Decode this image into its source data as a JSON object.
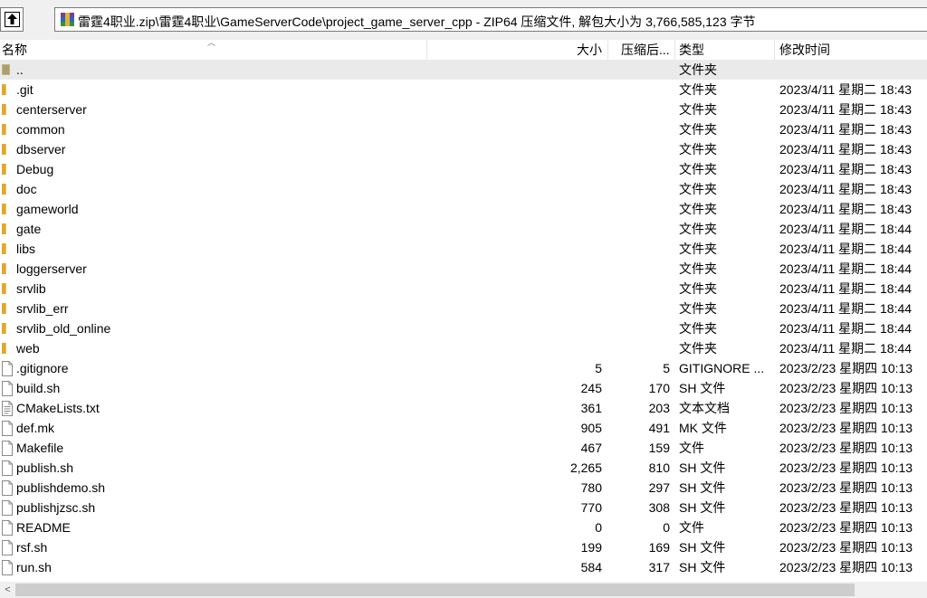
{
  "address_bar": {
    "path": "雷霆4职业.zip\\雷霆4职业\\GameServerCode\\project_game_server_cpp - ZIP64 压缩文件, 解包大小为 3,766,585,123 字节"
  },
  "columns": {
    "name": "名称",
    "size": "大小",
    "packed": "压缩后...",
    "type": "类型",
    "modified": "修改时间"
  },
  "colors": {
    "folder": "#f5c04a",
    "selected_row": "#eaeaea"
  },
  "rows": [
    {
      "icon": "parent-folder-icon",
      "name": "..",
      "size": "",
      "packed": "",
      "type": "文件夹",
      "modified": ""
    },
    {
      "icon": "folder-icon",
      "name": ".git",
      "size": "",
      "packed": "",
      "type": "文件夹",
      "modified": "2023/4/11 星期二 18:43"
    },
    {
      "icon": "folder-icon",
      "name": "centerserver",
      "size": "",
      "packed": "",
      "type": "文件夹",
      "modified": "2023/4/11 星期二 18:43"
    },
    {
      "icon": "folder-icon",
      "name": "common",
      "size": "",
      "packed": "",
      "type": "文件夹",
      "modified": "2023/4/11 星期二 18:43"
    },
    {
      "icon": "folder-icon",
      "name": "dbserver",
      "size": "",
      "packed": "",
      "type": "文件夹",
      "modified": "2023/4/11 星期二 18:43"
    },
    {
      "icon": "folder-icon",
      "name": "Debug",
      "size": "",
      "packed": "",
      "type": "文件夹",
      "modified": "2023/4/11 星期二 18:43"
    },
    {
      "icon": "folder-icon",
      "name": "doc",
      "size": "",
      "packed": "",
      "type": "文件夹",
      "modified": "2023/4/11 星期二 18:43"
    },
    {
      "icon": "folder-icon",
      "name": "gameworld",
      "size": "",
      "packed": "",
      "type": "文件夹",
      "modified": "2023/4/11 星期二 18:43"
    },
    {
      "icon": "folder-icon",
      "name": "gate",
      "size": "",
      "packed": "",
      "type": "文件夹",
      "modified": "2023/4/11 星期二 18:44"
    },
    {
      "icon": "folder-icon",
      "name": "libs",
      "size": "",
      "packed": "",
      "type": "文件夹",
      "modified": "2023/4/11 星期二 18:44"
    },
    {
      "icon": "folder-icon",
      "name": "loggerserver",
      "size": "",
      "packed": "",
      "type": "文件夹",
      "modified": "2023/4/11 星期二 18:44"
    },
    {
      "icon": "folder-icon",
      "name": "srvlib",
      "size": "",
      "packed": "",
      "type": "文件夹",
      "modified": "2023/4/11 星期二 18:44"
    },
    {
      "icon": "folder-icon",
      "name": "srvlib_err",
      "size": "",
      "packed": "",
      "type": "文件夹",
      "modified": "2023/4/11 星期二 18:44"
    },
    {
      "icon": "folder-icon",
      "name": "srvlib_old_online",
      "size": "",
      "packed": "",
      "type": "文件夹",
      "modified": "2023/4/11 星期二 18:44"
    },
    {
      "icon": "folder-icon",
      "name": "web",
      "size": "",
      "packed": "",
      "type": "文件夹",
      "modified": "2023/4/11 星期二 18:44"
    },
    {
      "icon": "file-icon",
      "name": ".gitignore",
      "size": "5",
      "packed": "5",
      "type": "GITIGNORE ...",
      "modified": "2023/2/23 星期四 10:13"
    },
    {
      "icon": "file-icon",
      "name": "build.sh",
      "size": "245",
      "packed": "170",
      "type": "SH 文件",
      "modified": "2023/2/23 星期四 10:13"
    },
    {
      "icon": "text-file-icon",
      "name": "CMakeLists.txt",
      "size": "361",
      "packed": "203",
      "type": "文本文档",
      "modified": "2023/2/23 星期四 10:13"
    },
    {
      "icon": "file-icon",
      "name": "def.mk",
      "size": "905",
      "packed": "491",
      "type": "MK 文件",
      "modified": "2023/2/23 星期四 10:13"
    },
    {
      "icon": "file-icon",
      "name": "Makefile",
      "size": "467",
      "packed": "159",
      "type": "文件",
      "modified": "2023/2/23 星期四 10:13"
    },
    {
      "icon": "file-icon",
      "name": "publish.sh",
      "size": "2,265",
      "packed": "810",
      "type": "SH 文件",
      "modified": "2023/2/23 星期四 10:13"
    },
    {
      "icon": "file-icon",
      "name": "publishdemo.sh",
      "size": "780",
      "packed": "297",
      "type": "SH 文件",
      "modified": "2023/2/23 星期四 10:13"
    },
    {
      "icon": "file-icon",
      "name": "publishjzsc.sh",
      "size": "770",
      "packed": "308",
      "type": "SH 文件",
      "modified": "2023/2/23 星期四 10:13"
    },
    {
      "icon": "file-icon",
      "name": "README",
      "size": "0",
      "packed": "0",
      "type": "文件",
      "modified": "2023/2/23 星期四 10:13"
    },
    {
      "icon": "file-icon",
      "name": "rsf.sh",
      "size": "199",
      "packed": "169",
      "type": "SH 文件",
      "modified": "2023/2/23 星期四 10:13"
    },
    {
      "icon": "file-icon",
      "name": "run.sh",
      "size": "584",
      "packed": "317",
      "type": "SH 文件",
      "modified": "2023/2/23 星期四 10:13"
    }
  ]
}
